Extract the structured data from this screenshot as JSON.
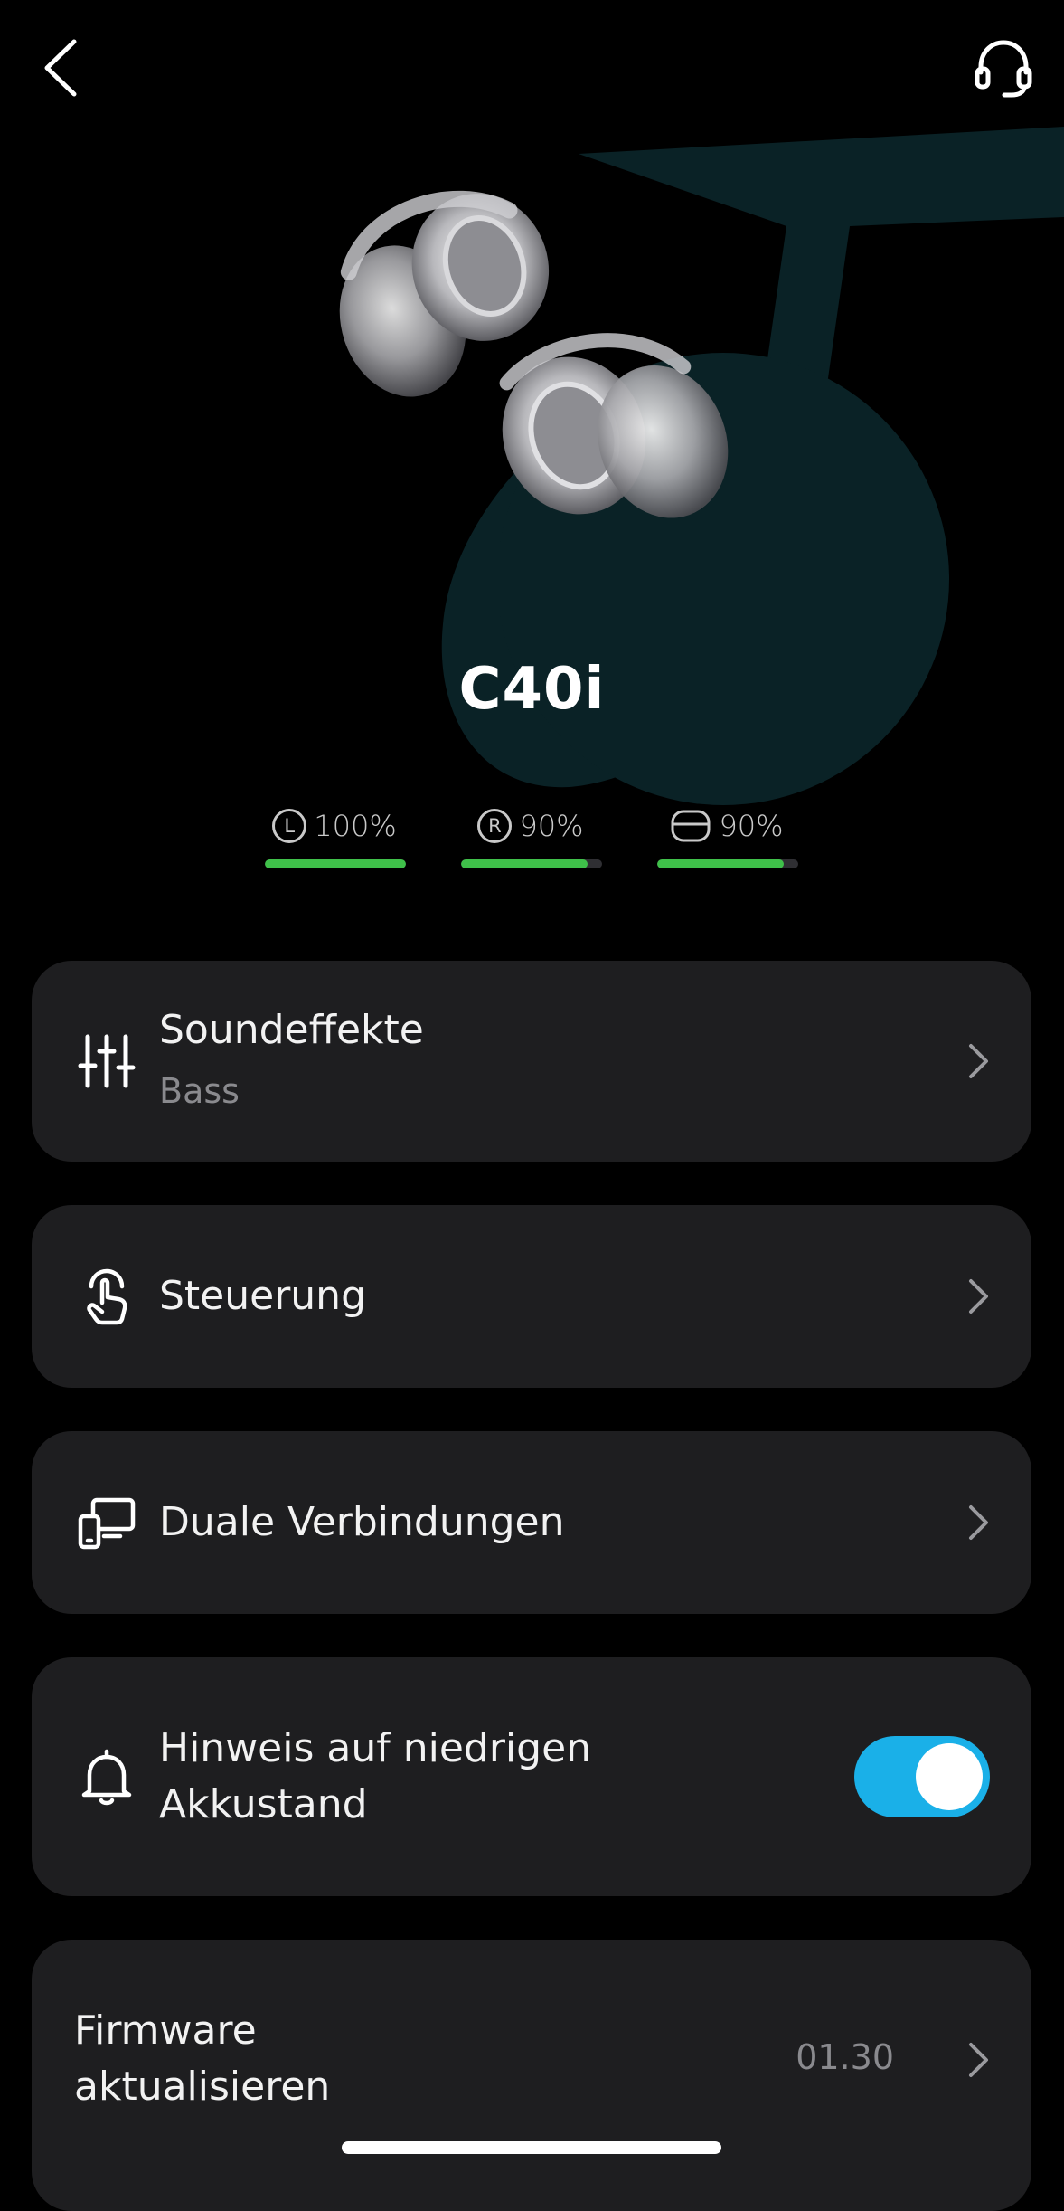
{
  "header": {
    "back_icon": "chevron-left-icon",
    "support_icon": "headset-support-icon"
  },
  "device": {
    "name": "C40i",
    "image": "earbuds-product-image"
  },
  "battery": [
    {
      "id": "left",
      "icon_label": "L",
      "value": "100%",
      "level": 1.0
    },
    {
      "id": "right",
      "icon_label": "R",
      "value": "90%",
      "level": 0.9
    },
    {
      "id": "case",
      "icon_label": "",
      "value": "90%",
      "level": 0.9
    }
  ],
  "menu": {
    "sound_effects": {
      "title": "Soundeffekte",
      "subtitle": "Bass",
      "icon": "equalizer-sliders-icon"
    },
    "controls": {
      "title": "Steuerung",
      "icon": "touch-gesture-icon"
    },
    "dual_connections": {
      "title": "Duale Verbindungen",
      "icon": "multi-device-icon"
    },
    "low_battery": {
      "title_line1": "Hinweis auf niedrigen",
      "title_line2": "Akkustand",
      "icon": "bell-icon",
      "enabled": true
    },
    "firmware": {
      "title_line1": "Firmware",
      "title_line2": "aktualisieren",
      "version": "01.30"
    }
  },
  "colors": {
    "background": "#000000",
    "card": "#1e1e20",
    "battery_green": "#3fc04a",
    "toggle_on": "#1ab0e8",
    "logo_teal": "#0b2a2e"
  }
}
